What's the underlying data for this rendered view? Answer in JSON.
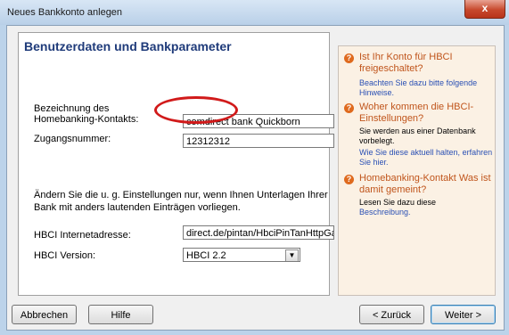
{
  "window": {
    "title": "Neues Bankkonto anlegen",
    "close_glyph": "x"
  },
  "main": {
    "heading": "Benutzerdaten und Bankparameter",
    "label_account_name_1": "Bezeichnung des",
    "label_account_name_2": "Homebanking-Kontakts:",
    "account_name_value": "comdirect bank Quickborn",
    "label_access_number": "Zugangsnummer:",
    "access_number_value": "12312312",
    "info_text": "Ändern Sie die u. g. Einstellungen nur, wenn Ihnen Unterlagen Ihrer Bank mit anders lautenden Einträgen vorliegen.",
    "label_hbci_address": "HBCI Internetadresse:",
    "hbci_address_value": "direct.de/pintan/HbciPinTanHttpGate",
    "label_hbci_version": "HBCI Version:",
    "hbci_version_value": "HBCI 2.2",
    "highlight_color": "#d11a1a"
  },
  "help": {
    "items": [
      {
        "icon": "question-icon",
        "title": "Ist Ihr Konto für HBCI freigeschaltet?",
        "text": "",
        "link": "Beachten Sie dazu bitte folgende Hinweise."
      },
      {
        "icon": "question-icon",
        "title": "Woher kommen die HBCI-Einstellungen?",
        "text": "Sie werden aus einer Datenbank vorbelegt.",
        "link": "Wie Sie diese aktuell halten, erfahren Sie hier."
      },
      {
        "icon": "question-icon",
        "title": "Homebanking-Kontakt Was ist damit gemeint?",
        "text": "Lesen Sie dazu diese",
        "link": "Beschreibung."
      }
    ]
  },
  "buttons": {
    "cancel": "Abbrechen",
    "help": "Hilfe",
    "back": "< Zurück",
    "next": "Weiter >"
  },
  "colors": {
    "heading": "#1f3b7a",
    "help_title": "#c0551c",
    "link": "#2a50b4",
    "icon": "#df6a1e"
  }
}
